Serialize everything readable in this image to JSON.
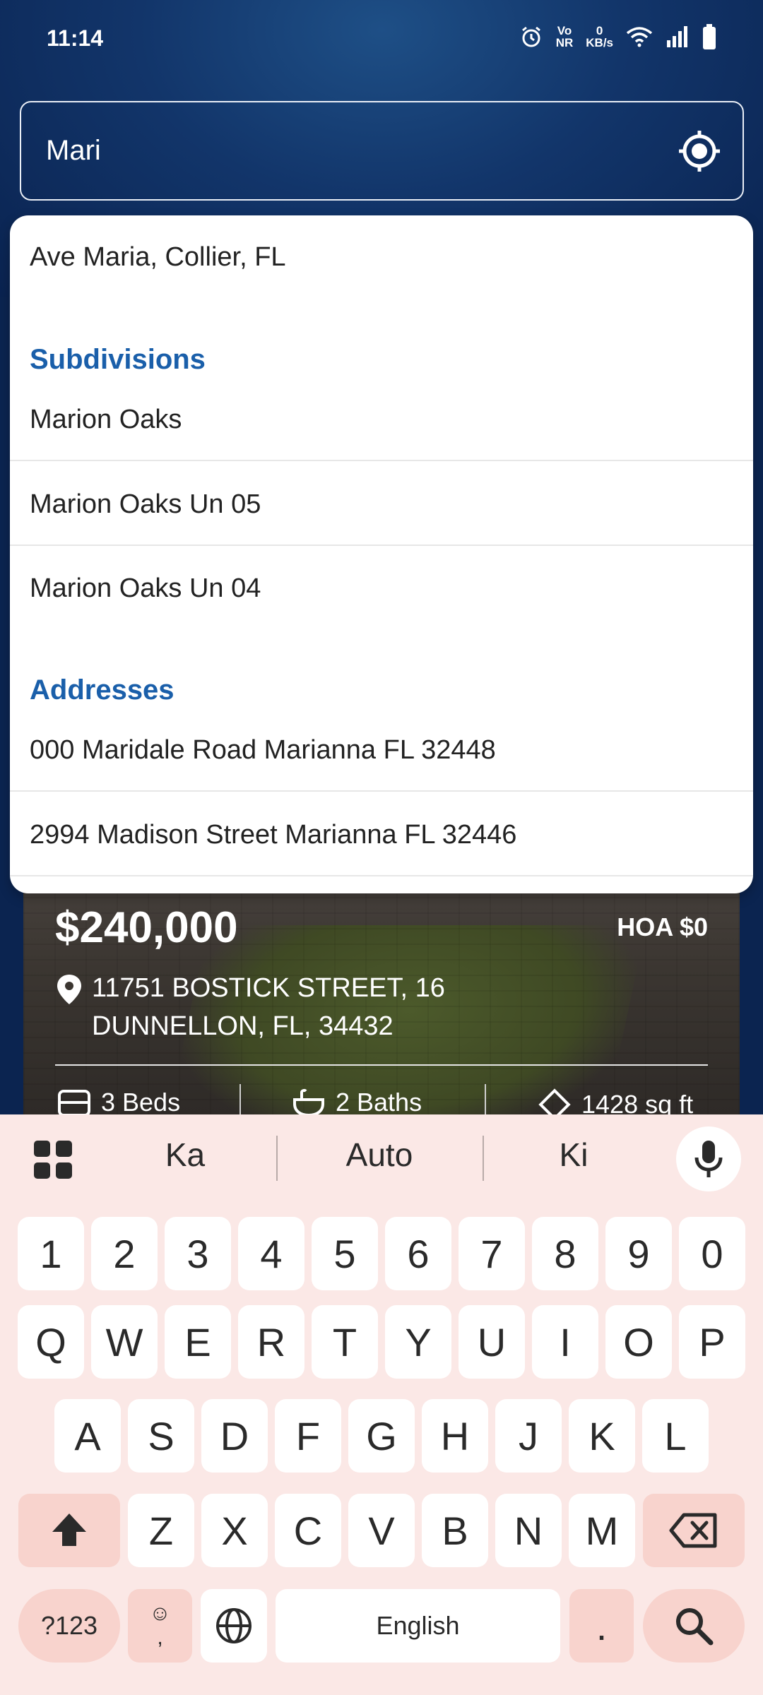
{
  "status_bar": {
    "time": "11:14",
    "net_top": "0",
    "net_bottom": "KB/s",
    "volte_top": "Vo",
    "volte_bottom": "NR"
  },
  "search": {
    "value": "Mari"
  },
  "dropdown": {
    "top_result": "Ave Maria, Collier, FL",
    "subdivisions_header": "Subdivisions",
    "subdivisions": [
      "Marion Oaks",
      "Marion Oaks Un 05",
      "Marion Oaks Un 04"
    ],
    "addresses_header": "Addresses",
    "addresses": [
      "000 Maridale Road Marianna FL 32448",
      "2994 Madison Street Marianna FL 32446"
    ]
  },
  "listing": {
    "price": "$240,000",
    "hoa": "HOA $0",
    "address_line1": "11751 BOSTICK STREET, 16",
    "address_line2": "DUNNELLON, FL, 34432",
    "beds": "3 Beds",
    "baths": "2 Baths",
    "sqft": "1428 sq ft"
  },
  "keyboard": {
    "suggestions": [
      "Ka",
      "Auto",
      "Ki"
    ],
    "numbers": [
      "1",
      "2",
      "3",
      "4",
      "5",
      "6",
      "7",
      "8",
      "9",
      "0"
    ],
    "row1": [
      "Q",
      "W",
      "E",
      "R",
      "T",
      "Y",
      "U",
      "I",
      "O",
      "P"
    ],
    "row2": [
      "A",
      "S",
      "D",
      "F",
      "G",
      "H",
      "J",
      "K",
      "L"
    ],
    "row3": [
      "Z",
      "X",
      "C",
      "V",
      "B",
      "N",
      "M"
    ],
    "symbols_label": "?123",
    "emoji_top": "☺",
    "emoji_bottom": ",",
    "space_label": "English",
    "period_label": "."
  },
  "colors": {
    "header_dark": "#0a2350",
    "section_header": "#1a5faa",
    "keyboard_bg": "#fbe8e6",
    "key_special": "#f8d3cd"
  }
}
